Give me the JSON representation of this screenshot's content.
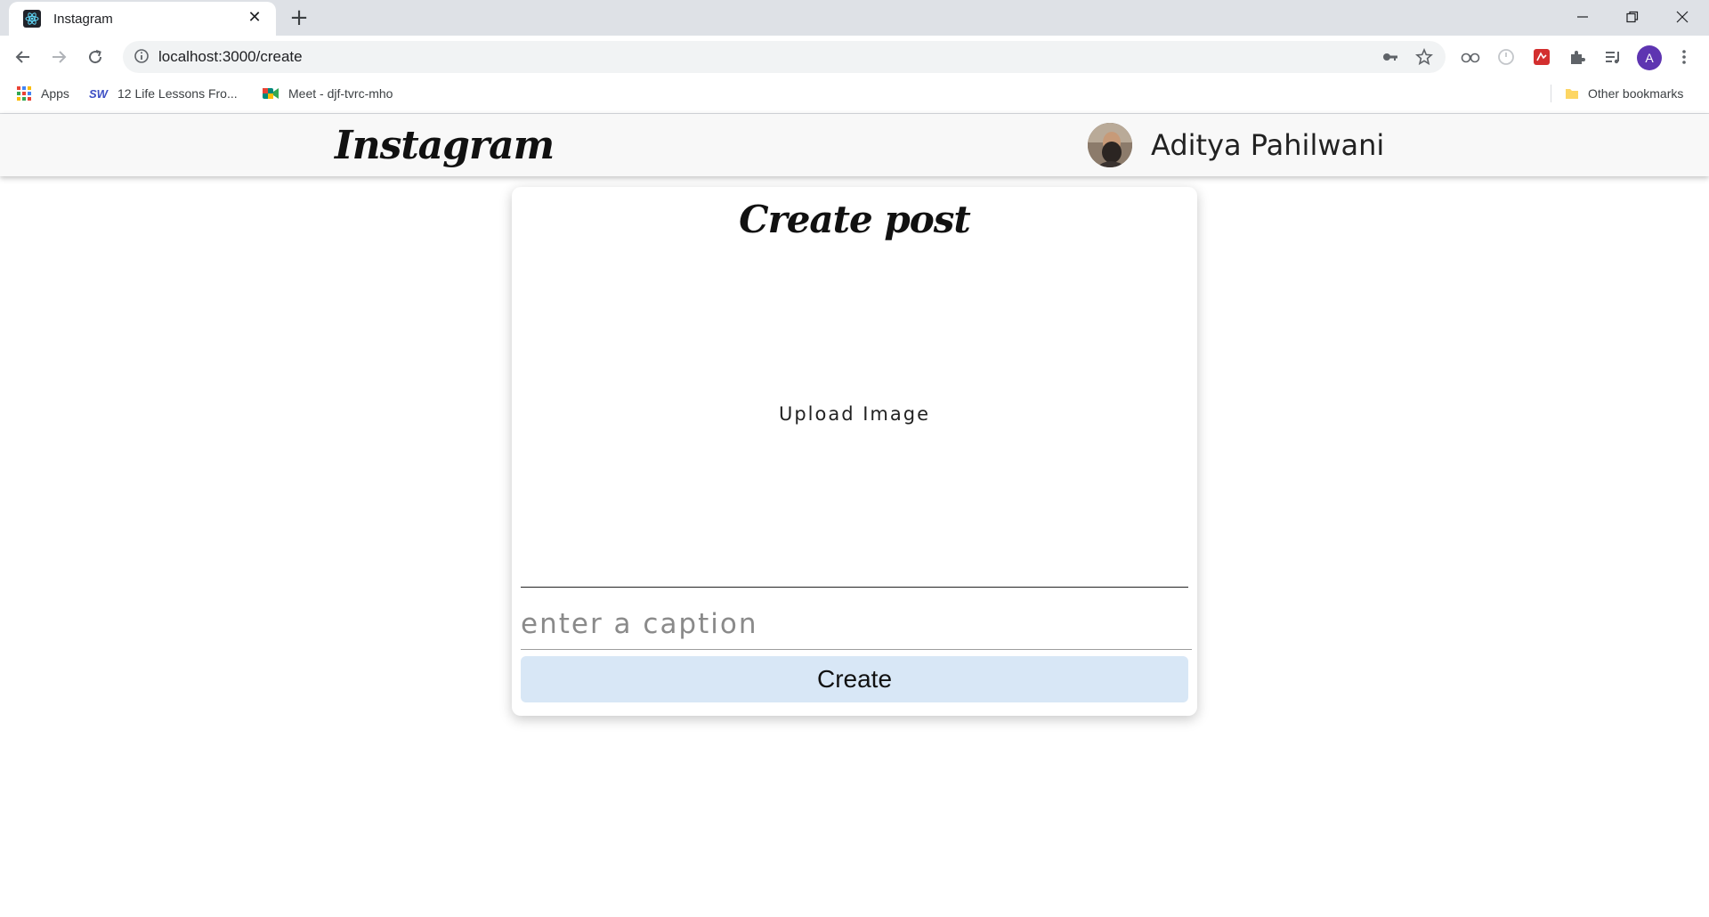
{
  "browser": {
    "tab_title": "Instagram",
    "url": "localhost:3000/create",
    "profile_initial": "A",
    "bookmarks": [
      {
        "label": "Apps",
        "icon": "apps-grid-icon"
      },
      {
        "label": "12 Life Lessons Fro...",
        "icon": "sw-icon"
      },
      {
        "label": "Meet - djf-tvrc-mho",
        "icon": "google-meet-icon"
      }
    ],
    "other_bookmarks": "Other bookmarks"
  },
  "nav": {
    "brand": "Instagram",
    "username": "Aditya Pahilwani"
  },
  "create": {
    "title": "Create post",
    "upload_label": "Upload Image",
    "caption_placeholder": "enter a caption",
    "caption_value": "",
    "button_label": "Create"
  },
  "colors": {
    "nav_bg": "#f8f8f8",
    "button_bg": "#d8e7f6",
    "profile_badge": "#5e35b1"
  }
}
